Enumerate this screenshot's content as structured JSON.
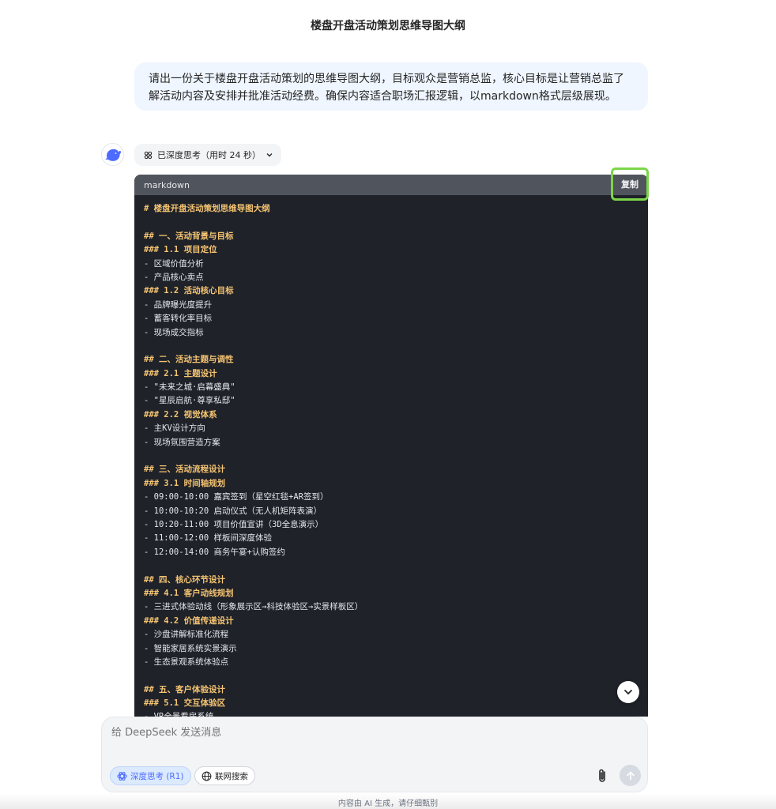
{
  "page": {
    "title": "楼盘开盘活动策划思维导图大纲"
  },
  "user_message": {
    "text": "请出一份关于楼盘开盘活动策划的思维导图大纲，目标观众是营销总监，核心目标是让营销总监了解活动内容及安排并批准活动经费。确保内容适合职场汇报逻辑，以markdown格式层级展现。"
  },
  "assistant": {
    "avatar_icon": "whale-logo-icon",
    "thinking_label": "已深度思考（用时 24 秒）"
  },
  "code_block": {
    "language": "markdown",
    "copy_label": "复制",
    "lines": [
      "# 楼盘开盘活动策划思维导图大纲",
      "",
      "## 一、活动背景与目标",
      "### 1.1 项目定位",
      "- 区域价值分析",
      "- 产品核心卖点",
      "### 1.2 活动核心目标",
      "- 品牌曝光度提升",
      "- 蓄客转化率目标",
      "- 现场成交指标",
      "",
      "## 二、活动主题与调性",
      "### 2.1 主题设计",
      "- \"未来之城·启幕盛典\"",
      "- \"星辰启航·尊享私邸\"",
      "### 2.2 视觉体系",
      "- 主KV设计方向",
      "- 现场氛围营造方案",
      "",
      "## 三、活动流程设计",
      "### 3.1 时间轴规划",
      "- 09:00-10:00 嘉宾签到（星空红毯+AR签到）",
      "- 10:00-10:20 启动仪式（无人机矩阵表演）",
      "- 10:20-11:00 项目价值宣讲（3D全息演示）",
      "- 11:00-12:00 样板间深度体验",
      "- 12:00-14:00 商务午宴+认购签约",
      "",
      "## 四、核心环节设计",
      "### 4.1 客户动线规划",
      "- 三进式体验动线（形象展示区→科技体验区→实景样板区）",
      "### 4.2 价值传递设计",
      "- 沙盘讲解标准化流程",
      "- 智能家居系统实景演示",
      "- 生态景观系统体验点",
      "",
      "## 五、客户体验设计",
      "### 5.1 交互体验区",
      "- VR全景看房系统"
    ]
  },
  "composer": {
    "placeholder": "给 DeepSeek 发送消息",
    "deep_think_label": "深度思考 (R1)",
    "web_search_label": "联网搜索"
  },
  "footer": {
    "note": "内容由 AI 生成，请仔细甄别"
  },
  "colors": {
    "accent": "#4d6bfe",
    "code_bg": "#1f2229",
    "heading": "#f5c472",
    "highlight": "#7bd64a"
  }
}
